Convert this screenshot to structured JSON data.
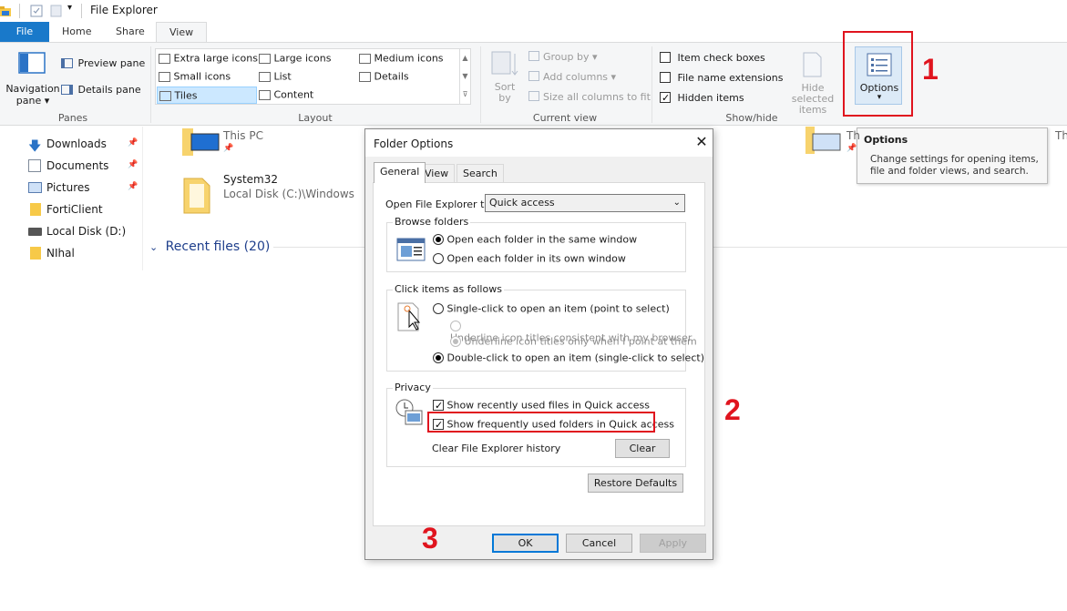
{
  "window": {
    "title": "File Explorer"
  },
  "tabs": [
    {
      "label": "File"
    },
    {
      "label": "Home"
    },
    {
      "label": "Share"
    },
    {
      "label": "View"
    }
  ],
  "ribbon": {
    "panes": {
      "navigation_pane": "Navigation pane ▾",
      "preview_pane": "Preview pane",
      "details_pane": "Details pane",
      "group_label": "Panes"
    },
    "layout": {
      "items": [
        "Extra large icons",
        "Large icons",
        "Medium icons",
        "Small icons",
        "List",
        "Details",
        "Tiles",
        "Content"
      ],
      "selected": "Tiles",
      "group_label": "Layout"
    },
    "current_view": {
      "sort_by": "Sort by",
      "group_by": "Group by ▾",
      "add_columns": "Add columns ▾",
      "size_columns": "Size all columns to fit",
      "group_label": "Current view"
    },
    "show_hide": {
      "item_check_boxes": {
        "label": "Item check boxes",
        "checked": false
      },
      "file_name_extensions": {
        "label": "File name extensions",
        "checked": false
      },
      "hidden_items": {
        "label": "Hidden items",
        "checked": true
      },
      "hide_selected": "Hide selected items",
      "group_label": "Show/hide"
    },
    "options": {
      "label": "Options",
      "arrow": "▾"
    }
  },
  "tooltip": {
    "title": "Options",
    "body": "Change settings for opening items, file and folder views, and search."
  },
  "nav": {
    "items": [
      {
        "label": "Downloads",
        "pinned": true
      },
      {
        "label": "Documents",
        "pinned": true
      },
      {
        "label": "Pictures",
        "pinned": true
      },
      {
        "label": "FortiClient",
        "pinned": false
      },
      {
        "label": "Local Disk (D:)",
        "pinned": false
      },
      {
        "label": "NIhal",
        "pinned": false
      }
    ],
    "pin_glyph": "📌"
  },
  "content": {
    "this_pc": "This PC",
    "system32": {
      "name": "System32",
      "path": "Local Disk (C:)\\Windows"
    },
    "recent_files": "Recent files (20)",
    "partial_right_1": "Th",
    "partial_right_2": "Th"
  },
  "dialog": {
    "title": "Folder Options",
    "close_glyph": "✕",
    "tabs": [
      "General",
      "View",
      "Search"
    ],
    "open_explorer_to_label": "Open File Explorer to:",
    "open_explorer_to_value": "Quick access",
    "browse_folders": {
      "legend": "Browse folders",
      "options": [
        {
          "label": "Open each folder in the same window",
          "checked": true
        },
        {
          "label": "Open each folder in its own window",
          "checked": false
        }
      ]
    },
    "click_items": {
      "legend": "Click items as follows",
      "single_click": {
        "label": "Single-click to open an item (point to select)",
        "checked": false
      },
      "underline_browser": {
        "label": "Underline icon titles consistent with my browser",
        "checked": false
      },
      "underline_point": {
        "label": "Underline icon titles only when I point at them",
        "checked": true
      },
      "double_click": {
        "label": "Double-click to open an item (single-click to select)",
        "checked": true
      }
    },
    "privacy": {
      "legend": "Privacy",
      "recent_files": {
        "label": "Show recently used files in Quick access",
        "checked": true
      },
      "frequent_folders": {
        "label": "Show frequently used folders in Quick access",
        "checked": true
      },
      "clear_history_label": "Clear File Explorer history",
      "clear_button": "Clear"
    },
    "restore_defaults": "Restore Defaults",
    "ok": "OK",
    "cancel": "Cancel",
    "apply": "Apply"
  },
  "annotations": {
    "step1": "1",
    "step2": "2",
    "step3": "3",
    "color": "#e0141e"
  }
}
